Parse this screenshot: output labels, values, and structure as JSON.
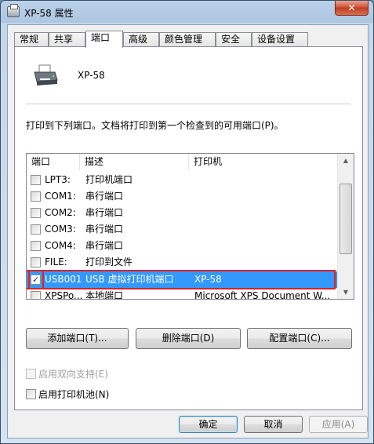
{
  "window": {
    "title": "XP-58 属性",
    "close_label": "✕"
  },
  "tabs": [
    {
      "label": "常规"
    },
    {
      "label": "共享"
    },
    {
      "label": "端口"
    },
    {
      "label": "高级"
    },
    {
      "label": "颜色管理"
    },
    {
      "label": "安全"
    },
    {
      "label": "设备设置"
    }
  ],
  "active_tab": "端口",
  "printer": {
    "name": "XP-58",
    "icon": "printer-icon"
  },
  "instruction": "打印到下列端口。文档将打印到第一个检查到的可用端口(P)。",
  "port_list": {
    "columns": {
      "port": "端口",
      "description": "描述",
      "printer": "打印机"
    },
    "rows": [
      {
        "port": "LPT3:",
        "description": "打印机端口",
        "printer": "",
        "checked": false,
        "selected": false
      },
      {
        "port": "COM1:",
        "description": "串行端口",
        "printer": "",
        "checked": false,
        "selected": false
      },
      {
        "port": "COM2:",
        "description": "串行端口",
        "printer": "",
        "checked": false,
        "selected": false
      },
      {
        "port": "COM3:",
        "description": "串行端口",
        "printer": "",
        "checked": false,
        "selected": false
      },
      {
        "port": "COM4:",
        "description": "串行端口",
        "printer": "",
        "checked": false,
        "selected": false
      },
      {
        "port": "FILE:",
        "description": "打印到文件",
        "printer": "",
        "checked": false,
        "selected": false
      },
      {
        "port": "USB001",
        "description": "USB 虚拟打印机端口",
        "printer": "XP-58",
        "checked": true,
        "selected": true
      },
      {
        "port": "XPSPo...",
        "description": "本地端口",
        "printer": "Microsoft XPS Document W...",
        "checked": false,
        "selected": false
      }
    ]
  },
  "buttons": {
    "add_port": "添加端口(T)...",
    "delete_port": "删除端口(D)",
    "configure_port": "配置端口(C)..."
  },
  "options": {
    "bidirectional": {
      "label": "启用双向支持(E)",
      "checked": false,
      "enabled": false
    },
    "pooling": {
      "label": "启用打印机池(N)",
      "checked": false,
      "enabled": true
    }
  },
  "footer": {
    "ok": "确定",
    "cancel": "取消",
    "apply": "应用(A)"
  },
  "colors": {
    "selection": "#3399ff",
    "highlight_box": "#e02020"
  }
}
